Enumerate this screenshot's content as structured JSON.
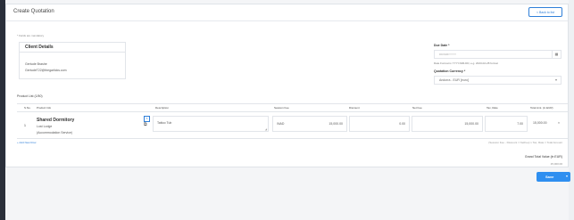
{
  "header": {
    "title": "Create Quotation",
    "back_label": "< Back to list"
  },
  "form": {
    "mandatory_note": "* Fields are mandatory",
    "client": {
      "title": "Client Details",
      "name": "Gertude Brashe",
      "email": "GertudeT22@thegarlicks.com"
    },
    "due_date": {
      "label": "Due Date *",
      "placeholder": "DD/MM/YYYY",
      "hint": "Date Format is YYYY-MM-DD, e.g. 2023-02-28 format"
    },
    "currency": {
      "label": "Quotation Currency *",
      "value": "Andorra - EUR [euro]"
    }
  },
  "products": {
    "label": "Product List (1/50)",
    "columns": [
      "S.No.",
      "Product Info",
      "Description",
      "Session Fee",
      "Discount",
      "Net Fee",
      "Tax, Rate",
      "Total Amt. (in EUR)"
    ],
    "rows": [
      {
        "sno": "1",
        "name": "Shared Dormitory",
        "line2": "Lost Lodge",
        "line3": "(Accommodation Service)",
        "description": "Tattoo Tub",
        "session_unit": "/NAD",
        "session_fee": "15,000.00",
        "discount": "0.00",
        "net_fee": "15,000.00",
        "tax_rate": "7.00",
        "total": "15,000.00"
      }
    ],
    "add_row": "+ Add New Row",
    "formula": "(Session Fee - Discount = NetFee) x Tax, Rate = Total Amount"
  },
  "totals": {
    "grand_label": "Grand Total Value (in EUR)",
    "grand_value": "15,000.00"
  },
  "actions": {
    "save_label": "Save"
  }
}
